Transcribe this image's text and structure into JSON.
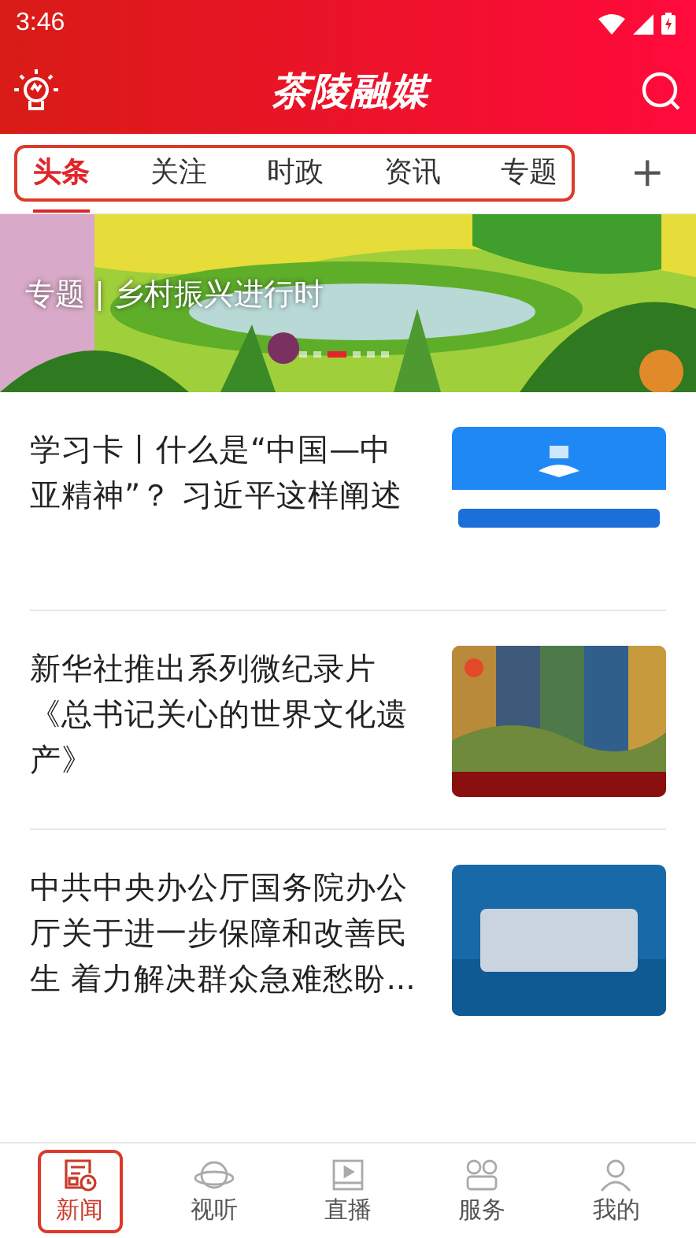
{
  "status_bar": {
    "time": "3:46"
  },
  "header": {
    "title": "茶陵融媒"
  },
  "tabs": [
    {
      "label": "头条",
      "selected": true
    },
    {
      "label": "关注",
      "selected": false
    },
    {
      "label": "时政",
      "selected": false
    },
    {
      "label": "资讯",
      "selected": false
    },
    {
      "label": "专题",
      "selected": false
    }
  ],
  "add_tab": {
    "label": "+"
  },
  "banner": {
    "caption": "专题 | 乡村振兴进行时",
    "pages": [
      {
        "selected": false
      },
      {
        "selected": false
      },
      {
        "selected": true
      },
      {
        "selected": false
      },
      {
        "selected": false
      },
      {
        "selected": false
      }
    ]
  },
  "articles": [
    {
      "title": "学习卡丨什么是“中国—中亚精神”？ 习近平这样阐述"
    },
    {
      "title": "新华社推出系列微纪录片《总书记关心的世界文化遗产》"
    },
    {
      "title": "中共中央办公厅国务院办公厅关于进一步保障和改善民生 着力解决群众急难愁盼..."
    }
  ],
  "bottom_nav": [
    {
      "label": "新闻",
      "selected": true
    },
    {
      "label": "视听",
      "selected": false
    },
    {
      "label": "直播",
      "selected": false
    },
    {
      "label": "服务",
      "selected": false
    },
    {
      "label": "我的",
      "selected": false
    }
  ]
}
